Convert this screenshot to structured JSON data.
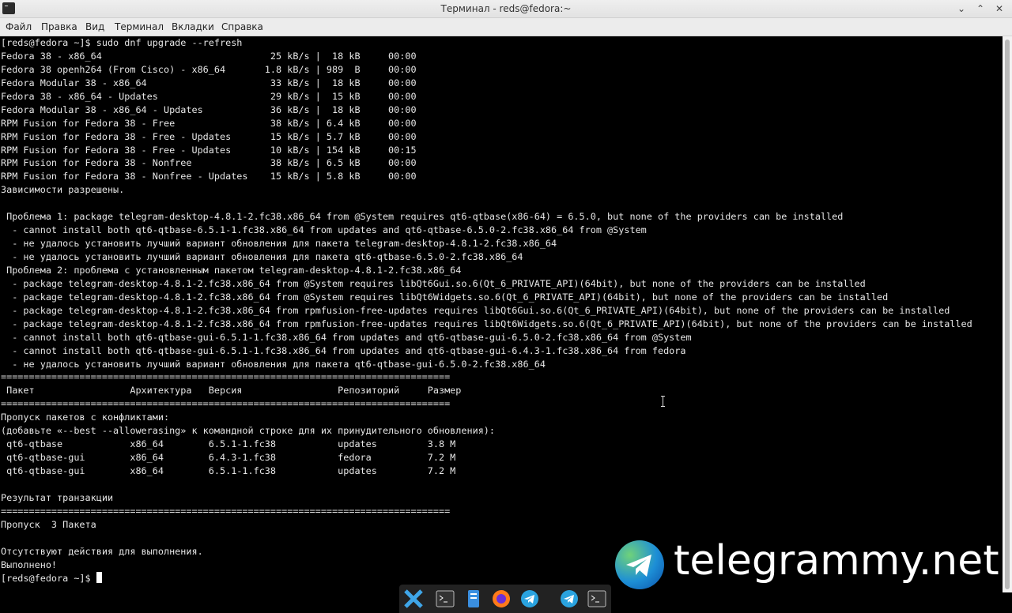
{
  "window": {
    "title": "Терминал - reds@fedora:~",
    "controls": [
      "minimize-icon",
      "maximize-icon",
      "close-icon"
    ]
  },
  "menu": {
    "items": [
      "Файл",
      "Правка",
      "Вид",
      "Терминал",
      "Вкладки",
      "Справка"
    ]
  },
  "terminal": {
    "lines": [
      "[reds@fedora ~]$ sudo dnf upgrade --refresh",
      "Fedora 38 - x86_64                              25 kB/s |  18 kB     00:00",
      "Fedora 38 openh264 (From Cisco) - x86_64       1.8 kB/s | 989  B     00:00",
      "Fedora Modular 38 - x86_64                      33 kB/s |  18 kB     00:00",
      "Fedora 38 - x86_64 - Updates                    29 kB/s |  15 kB     00:00",
      "Fedora Modular 38 - x86_64 - Updates            36 kB/s |  18 kB     00:00",
      "RPM Fusion for Fedora 38 - Free                 38 kB/s | 6.4 kB     00:00",
      "RPM Fusion for Fedora 38 - Free - Updates       15 kB/s | 5.7 kB     00:00",
      "RPM Fusion for Fedora 38 - Free - Updates       10 kB/s | 154 kB     00:15",
      "RPM Fusion for Fedora 38 - Nonfree              38 kB/s | 6.5 kB     00:00",
      "RPM Fusion for Fedora 38 - Nonfree - Updates    15 kB/s | 5.8 kB     00:00",
      "Зависимости разрешены.",
      "",
      " Проблема 1: package telegram-desktop-4.8.1-2.fc38.x86_64 from @System requires qt6-qtbase(x86-64) = 6.5.0, but none of the providers can be installed",
      "  - cannot install both qt6-qtbase-6.5.1-1.fc38.x86_64 from updates and qt6-qtbase-6.5.0-2.fc38.x86_64 from @System",
      "  - не удалось установить лучший вариант обновления для пакета telegram-desktop-4.8.1-2.fc38.x86_64",
      "  - не удалось установить лучший вариант обновления для пакета qt6-qtbase-6.5.0-2.fc38.x86_64",
      " Проблема 2: проблема с установленным пакетом telegram-desktop-4.8.1-2.fc38.x86_64",
      "  - package telegram-desktop-4.8.1-2.fc38.x86_64 from @System requires libQt6Gui.so.6(Qt_6_PRIVATE_API)(64bit), but none of the providers can be installed",
      "  - package telegram-desktop-4.8.1-2.fc38.x86_64 from @System requires libQt6Widgets.so.6(Qt_6_PRIVATE_API)(64bit), but none of the providers can be installed",
      "  - package telegram-desktop-4.8.1-2.fc38.x86_64 from rpmfusion-free-updates requires libQt6Gui.so.6(Qt_6_PRIVATE_API)(64bit), but none of the providers can be installed",
      "  - package telegram-desktop-4.8.1-2.fc38.x86_64 from rpmfusion-free-updates requires libQt6Widgets.so.6(Qt_6_PRIVATE_API)(64bit), but none of the providers can be installed",
      "  - cannot install both qt6-qtbase-gui-6.5.1-1.fc38.x86_64 from updates and qt6-qtbase-gui-6.5.0-2.fc38.x86_64 from @System",
      "  - cannot install both qt6-qtbase-gui-6.5.1-1.fc38.x86_64 from updates and qt6-qtbase-gui-6.4.3-1.fc38.x86_64 from fedora",
      "  - не удалось установить лучший вариант обновления для пакета qt6-qtbase-gui-6.5.0-2.fc38.x86_64",
      "================================================================================",
      " Пакет                 Архитектура   Версия                 Репозиторий     Размер",
      "================================================================================",
      "Пропуск пакетов с конфликтами:",
      "(добавьте «--best --allowerasing» к командной строке для их принудительного обновления):",
      " qt6-qtbase            x86_64        6.5.1-1.fc38           updates         3.8 M",
      " qt6-qtbase-gui        x86_64        6.4.3-1.fc38           fedora          7.2 M",
      " qt6-qtbase-gui        x86_64        6.5.1-1.fc38           updates         7.2 M",
      "",
      "Результат транзакции",
      "================================================================================",
      "Пропуск  3 Пакета",
      "",
      "Отсутствуют действия для выполнения.",
      "Выполнено!"
    ],
    "prompt": "[reds@fedora ~]$ "
  },
  "watermark": {
    "text": "telegrammy.net",
    "icon": "telegram-logo-icon"
  },
  "taskbar": {
    "items": [
      "xfce-menu-icon",
      "terminal-icon",
      "file-manager-icon",
      "firefox-icon",
      "telegram-icon",
      "telegram-icon",
      "terminal-icon"
    ]
  },
  "colors": {
    "terminal_bg": "#000000",
    "terminal_fg": "#e6e6e6",
    "titlebar_bg": "#ececec",
    "telegram_blue": "#2aa3df"
  }
}
